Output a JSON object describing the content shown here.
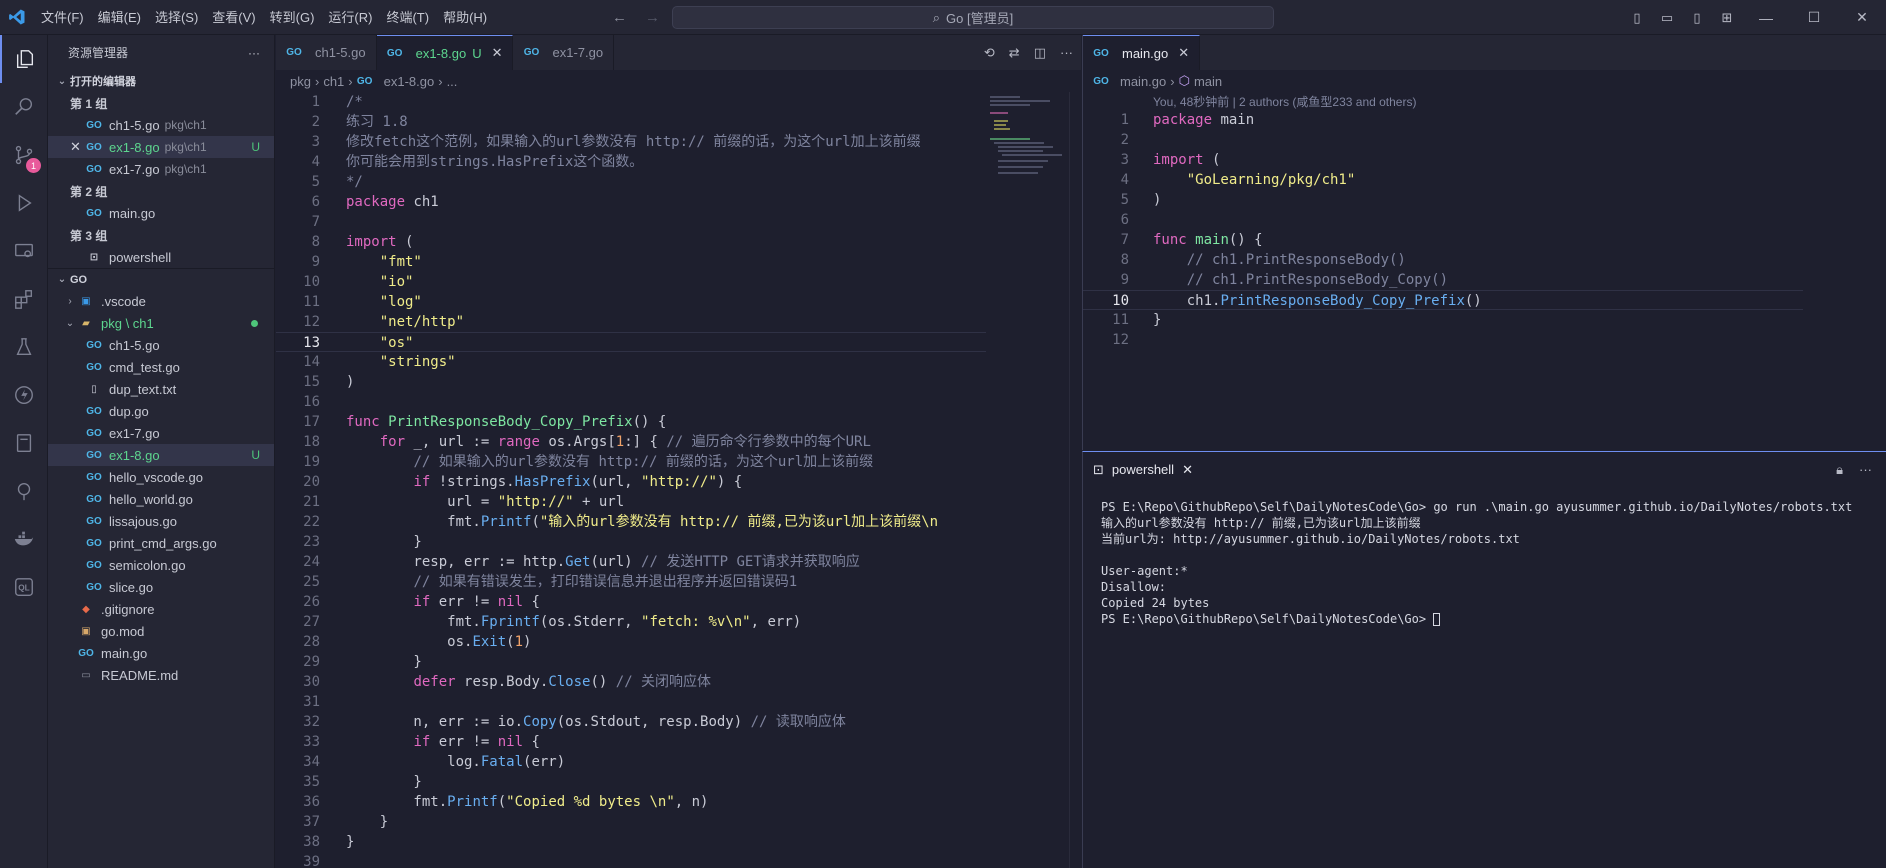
{
  "menu": [
    "文件(F)",
    "编辑(E)",
    "选择(S)",
    "查看(V)",
    "转到(G)",
    "运行(R)",
    "终端(T)",
    "帮助(H)"
  ],
  "search": "Go [管理员]",
  "sidebar": {
    "title": "资源管理器",
    "open_editors": "打开的编辑器",
    "groups": [
      {
        "label": "第 1 组",
        "items": [
          {
            "name": "ch1-5.go",
            "desc": "pkg\\ch1"
          },
          {
            "name": "ex1-8.go",
            "desc": "pkg\\ch1",
            "status": "U"
          },
          {
            "name": "ex1-7.go",
            "desc": "pkg\\ch1"
          }
        ]
      },
      {
        "label": "第 2 组",
        "items": [
          {
            "name": "main.go"
          }
        ]
      },
      {
        "label": "第 3 组",
        "items": [
          {
            "name": "powershell"
          }
        ]
      }
    ],
    "project": "GO",
    "tree": {
      "vscode": ".vscode",
      "pkg": "pkg \\ ch1",
      "files": [
        "ch1-5.go",
        "cmd_test.go",
        "dup_text.txt",
        "dup.go",
        "ex1-7.go",
        "ex1-8.go",
        "hello_vscode.go",
        "hello_world.go",
        "lissajous.go",
        "print_cmd_args.go",
        "semicolon.go",
        "slice.go"
      ],
      "u_status": "U",
      "root_files": [
        ".gitignore",
        "go.mod",
        "main.go",
        "README.md"
      ]
    }
  },
  "left_tabs": [
    {
      "label": "ch1-5.go"
    },
    {
      "label": "ex1-8.go",
      "status": "U"
    },
    {
      "label": "ex1-7.go"
    }
  ],
  "left_crumbs": [
    "pkg",
    "ch1",
    "ex1-8.go",
    "..."
  ],
  "right_tab": "main.go",
  "right_crumbs": [
    "main.go",
    "main"
  ],
  "blame": "You, 48秒钟前 | 2 authors (咸鱼型233 and others)",
  "terminal": {
    "tab": "powershell",
    "lines": [
      "PS E:\\Repo\\GithubRepo\\Self\\DailyNotesCode\\Go> go run .\\main.go ayusummer.github.io/DailyNotes/robots.txt",
      "输入的url参数没有 http:// 前缀,已为该url加上该前缀",
      "当前url为: http://ayusummer.github.io/DailyNotes/robots.txt",
      "",
      "User-agent:*",
      "Disallow:",
      "Copied 24 bytes"
    ],
    "prompt": "PS E:\\Repo\\GithubRepo\\Self\\DailyNotesCode\\Go> "
  },
  "badge": "1",
  "colors": {
    "accent": "#6e8ef0",
    "keyword": "#e069c0",
    "func": "#7ee6a2",
    "string": "#f0ec8a",
    "comment": "#7f849e"
  }
}
